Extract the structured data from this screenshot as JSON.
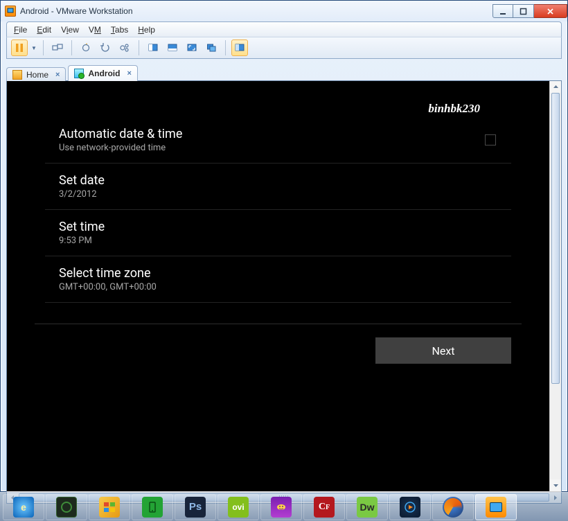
{
  "window": {
    "title": "Android - VMware Workstation"
  },
  "menu": {
    "file": "File",
    "edit": "Edit",
    "view": "View",
    "vm": "VM",
    "tabs": "Tabs",
    "help": "Help"
  },
  "tabs": {
    "home": {
      "label": "Home"
    },
    "android": {
      "label": "Android"
    }
  },
  "android_setup": {
    "watermark": "binhbk230",
    "rows": [
      {
        "title": "Automatic date & time",
        "sub": "Use network-provided time",
        "has_checkbox": true
      },
      {
        "title": "Set date",
        "sub": "3/2/2012",
        "has_checkbox": false
      },
      {
        "title": "Set time",
        "sub": "9:53 PM",
        "has_checkbox": false
      },
      {
        "title": "Select time zone",
        "sub": "GMT+00:00, GMT+00:00",
        "has_checkbox": false
      }
    ],
    "next_label": "Next"
  },
  "taskbar_apps": [
    "internet-explorer",
    "dark-app",
    "windows-explorer",
    "device-app",
    "photoshop",
    "ovi",
    "yahoo-messenger",
    "cold-fusion",
    "dreamweaver",
    "media-player",
    "firefox",
    "vmware-workstation"
  ],
  "task_labels": {
    "ps": "Ps",
    "ovi": "ovi",
    "cf": "CF",
    "dw": "Dw"
  }
}
